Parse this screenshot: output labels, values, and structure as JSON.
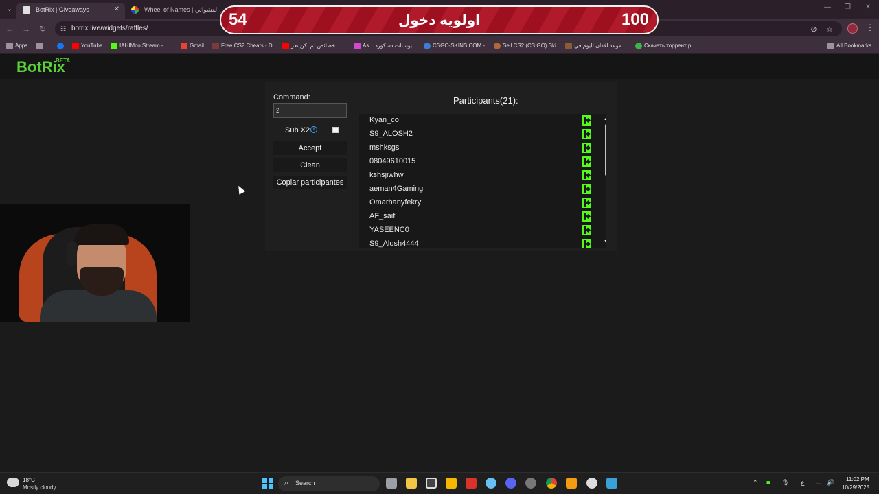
{
  "browser": {
    "tabs": [
      {
        "title": "BotRix | Giveaways",
        "active": true
      },
      {
        "title": "Wheel of Names | سم العشوائي",
        "active": false
      }
    ],
    "url": "botrix.live/widgets/raffles/",
    "bookmarks": [
      {
        "label": "Apps",
        "icon": "apps-grid-icon",
        "color": "#cfc6cf"
      },
      {
        "label": "",
        "icon": "grid-icon",
        "color": "#cfc6cf"
      },
      {
        "label": "",
        "icon": "facebook-icon",
        "color": "#1877f2"
      },
      {
        "label": "YouTube",
        "icon": "youtube-icon",
        "color": "#ff0000"
      },
      {
        "label": "IAHIMco Stream -...",
        "icon": "kick-icon",
        "color": "#53fc18"
      },
      {
        "label": "Gmail",
        "icon": "gmail-icon",
        "color": "#ea4335"
      },
      {
        "label": "Free CS2 Cheats - D...",
        "icon": "cheats-icon",
        "color": "#7a3b3b"
      },
      {
        "label": "خصائص لم تكن تعر...",
        "icon": "youtube-icon",
        "color": "#ff0000"
      },
      {
        "label": "As... بوستات دسكورد",
        "icon": "gem-icon",
        "color": "#d048d0"
      },
      {
        "label": "CSGO-SKINS.COM -...",
        "icon": "csgo-skins-icon",
        "color": "#3c7dd9"
      },
      {
        "label": "Sell CS2 (CS:GO) Ski...",
        "icon": "sell-skins-icon",
        "color": "#b0683a"
      },
      {
        "label": "موعد الاذان اليوم في...",
        "icon": "prayer-icon",
        "color": "#8a5a3a"
      },
      {
        "label": "Скачать торрент р...",
        "icon": "torrent-icon",
        "color": "#3bb54a"
      },
      {
        "label": "All Bookmarks",
        "icon": "folder-icon",
        "color": "#cfc6cf"
      }
    ]
  },
  "app": {
    "logo": "BotRix",
    "logo_badge": "BETA"
  },
  "panel": {
    "command_label": "Command:",
    "command_value": "2",
    "sub_label": "Sub X2",
    "sub_checked": false,
    "accept_label": "Accept",
    "clean_label": "Clean",
    "copy_label": "Copiar participantes",
    "participants_title": "Participants(21):",
    "participants": [
      "Kyan_co",
      "S9_ALOSH2",
      "mshksgs",
      "08049610015",
      "kshsjiwhw",
      "aeman4Gaming",
      "Omarhanyfekry",
      "AF_saif",
      "YASEENC0",
      "S9_Alosh4444"
    ]
  },
  "overlay": {
    "left": "54",
    "center": "اولويه دخول",
    "right": "100"
  },
  "taskbar": {
    "temperature": "18°C",
    "weather": "Mostly cloudy",
    "search_label": "Search",
    "language": "ع",
    "time": "11:02 PM",
    "date": "10/29/2025",
    "apps": [
      {
        "name": "file-explorer-icon",
        "color": "#f0c24a"
      },
      {
        "name": "taskview-icon",
        "color": "#9aa0a6"
      },
      {
        "name": "folder-icon",
        "color": "#f3c546"
      },
      {
        "name": "g-app-icon",
        "color": "#dddddd"
      },
      {
        "name": "yellow-app-icon",
        "color": "#f5b800"
      },
      {
        "name": "red-app-icon",
        "color": "#d8322b"
      },
      {
        "name": "steam-icon",
        "color": "#66c0f4"
      },
      {
        "name": "discord-icon",
        "color": "#5865f2"
      },
      {
        "name": "sync-icon",
        "color": "#cccccc"
      },
      {
        "name": "chrome-icon",
        "color": "#4285f4"
      },
      {
        "name": "orange-app-icon",
        "color": "#f39c12"
      },
      {
        "name": "settings-icon",
        "color": "#dddddd"
      },
      {
        "name": "notepad-icon",
        "color": "#3aa0d8"
      }
    ]
  }
}
